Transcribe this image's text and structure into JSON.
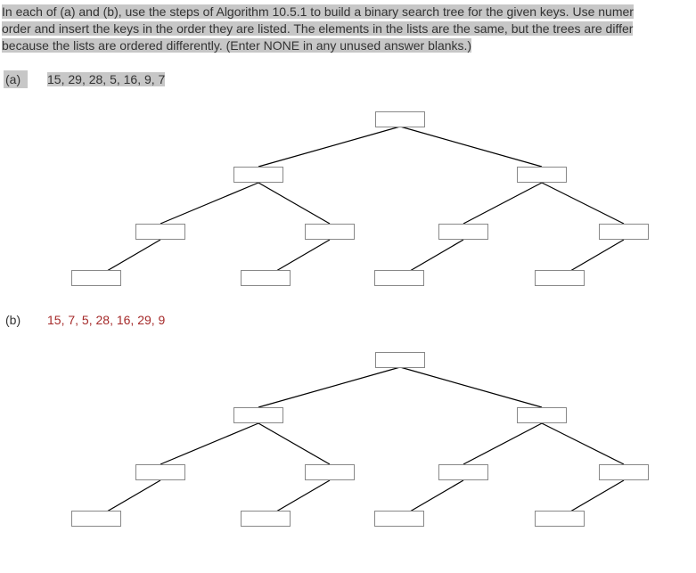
{
  "instructions": {
    "line1a": "In each of (a) and (b), use the steps of Algorithm 10.5.1 to build a binary search tree for the given keys. Use numer",
    "line2a": "order and insert the keys in the order they are listed. The elements in the lists are the same, but the trees are differ",
    "line3a": "because the lists are ordered differently. (Enter NONE in any unused answer blanks.)"
  },
  "partA": {
    "label": "(a)",
    "list": "15, 29, 28, 5, 16, 9, 7"
  },
  "partB": {
    "label": "(b)",
    "list": "15, 7, 5, 28, 16, 29, 9"
  },
  "nodes": {
    "root": "",
    "l": "",
    "r": "",
    "ll": "",
    "lr": "",
    "rl": "",
    "rr": "",
    "lll": "",
    "lrl": "",
    "rll": "",
    "rrl": ""
  }
}
